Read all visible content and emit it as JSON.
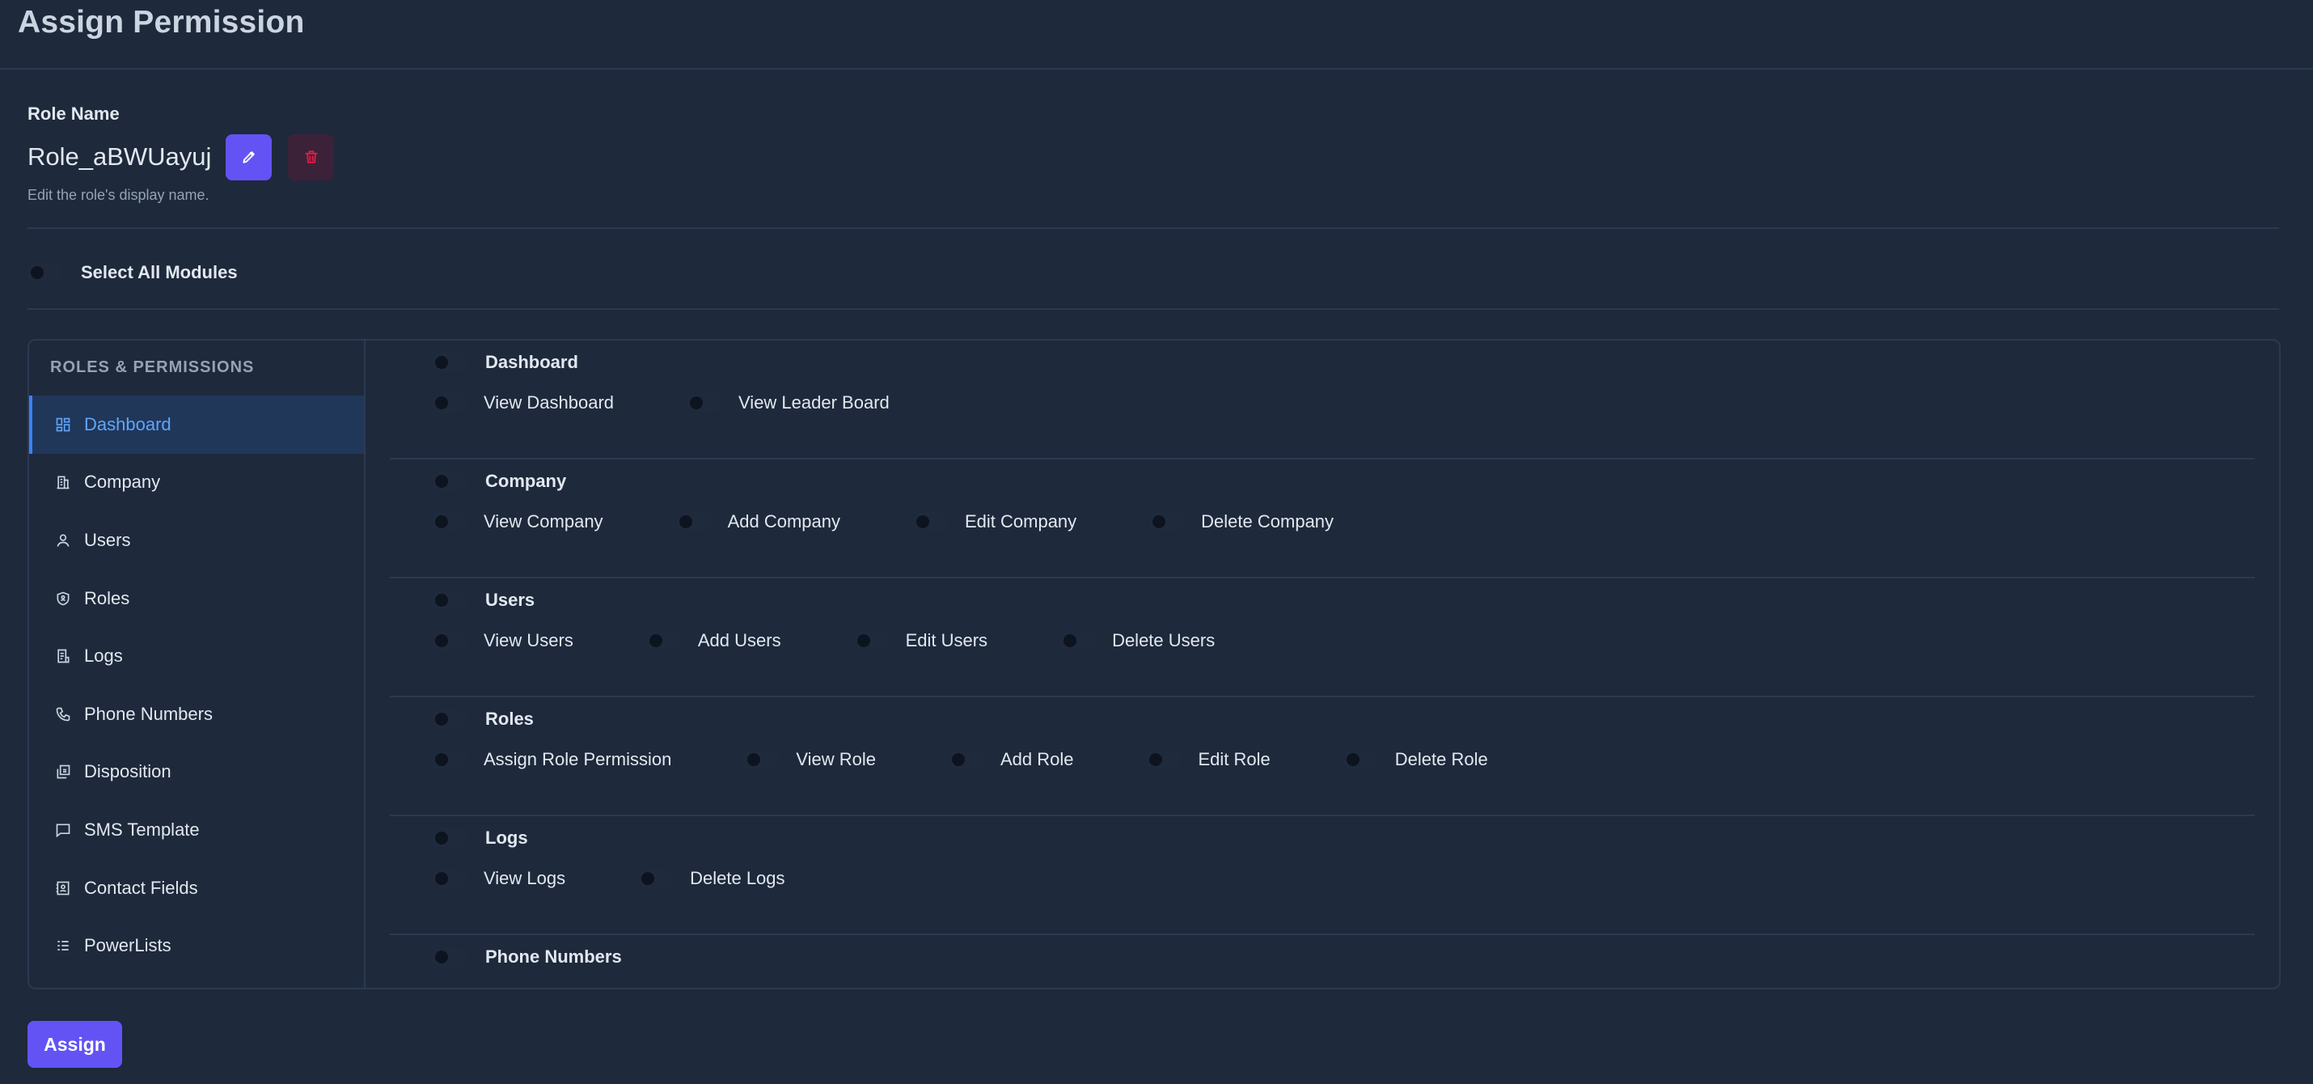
{
  "page": {
    "title": "Assign Permission"
  },
  "role": {
    "label": "Role Name",
    "value": "Role_aBWUayuj",
    "help": "Edit the role's display name."
  },
  "select_all": {
    "label": "Select All Modules",
    "checked": false
  },
  "sidebar": {
    "heading": "ROLES & PERMISSIONS",
    "items": [
      {
        "label": "Dashboard",
        "icon": "dashboard-icon",
        "active": true
      },
      {
        "label": "Company",
        "icon": "building-icon"
      },
      {
        "label": "Users",
        "icon": "user-icon"
      },
      {
        "label": "Roles",
        "icon": "shield-icon"
      },
      {
        "label": "Logs",
        "icon": "log-icon"
      },
      {
        "label": "Phone Numbers",
        "icon": "phone-icon"
      },
      {
        "label": "Disposition",
        "icon": "disposition-icon"
      },
      {
        "label": "SMS Template",
        "icon": "message-icon"
      },
      {
        "label": "Contact Fields",
        "icon": "contact-icon"
      },
      {
        "label": "PowerLists",
        "icon": "list-icon"
      }
    ]
  },
  "modules": [
    {
      "title": "Dashboard",
      "permissions": [
        "View Dashboard",
        "View Leader Board"
      ]
    },
    {
      "title": "Company",
      "permissions": [
        "View Company",
        "Add Company",
        "Edit Company",
        "Delete Company"
      ]
    },
    {
      "title": "Users",
      "permissions": [
        "View Users",
        "Add Users",
        "Edit Users",
        "Delete Users"
      ]
    },
    {
      "title": "Roles",
      "permissions": [
        "Assign Role Permission",
        "View Role",
        "Add Role",
        "Edit Role",
        "Delete Role"
      ]
    },
    {
      "title": "Logs",
      "permissions": [
        "View Logs",
        "Delete Logs"
      ]
    },
    {
      "title": "Phone Numbers",
      "permissions": []
    }
  ],
  "actions": {
    "assign_label": "Assign"
  },
  "colors": {
    "background": "#1e293b",
    "accent": "#6353f5",
    "active_item": "#60a5fa",
    "danger": "#e11d48"
  }
}
